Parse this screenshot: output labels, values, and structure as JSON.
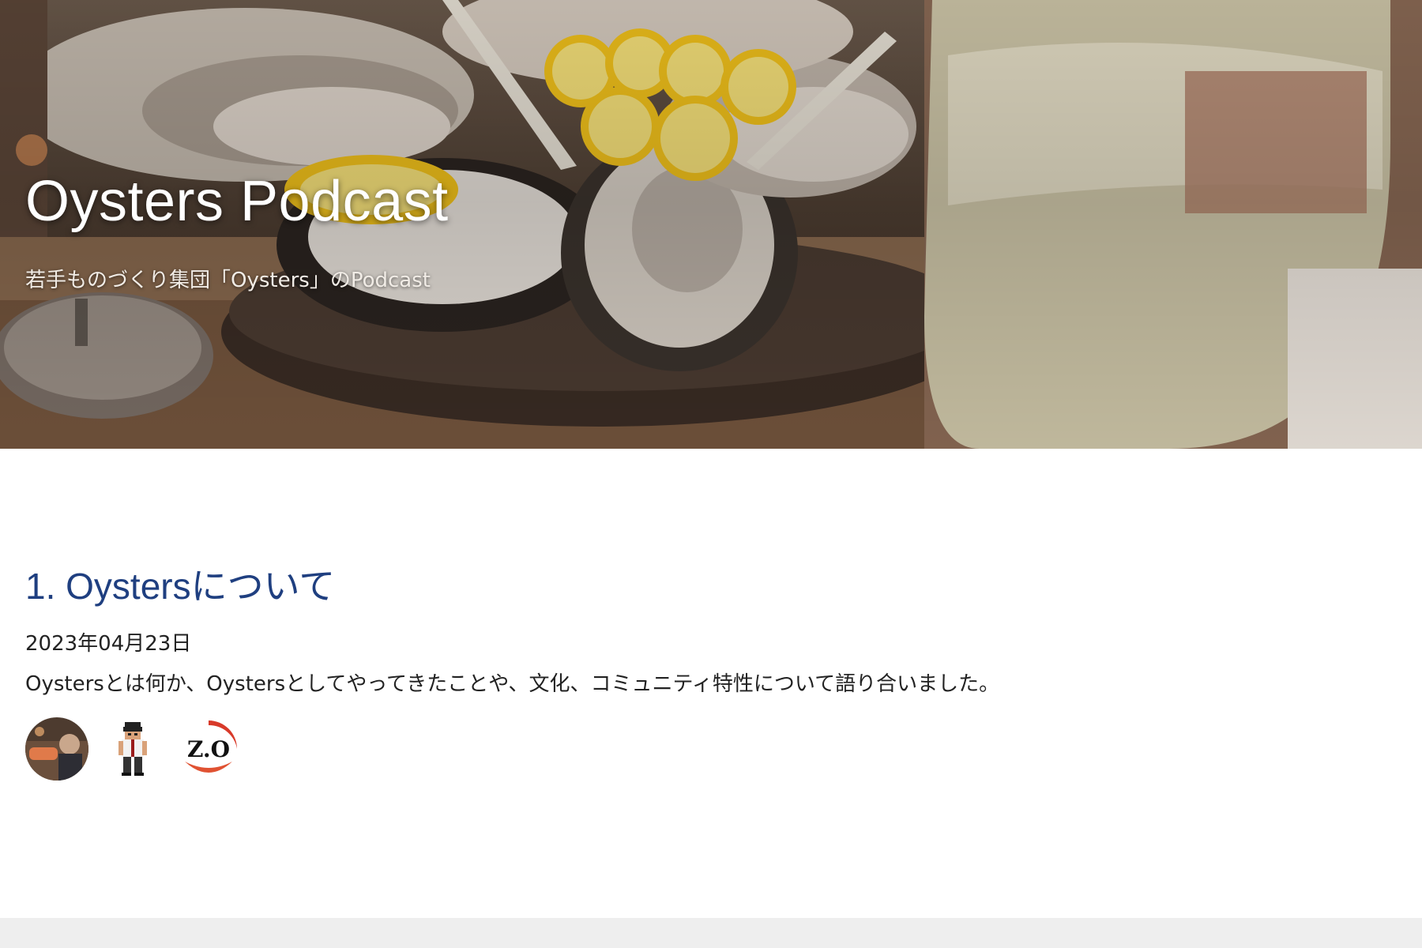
{
  "hero": {
    "title": "Oysters Podcast",
    "subtitle": "若手ものづくり集団「Oysters」のPodcast"
  },
  "episode": {
    "title": "1. Oystersについて",
    "date": "2023年04月23日",
    "description": "Oystersとは何か、Oystersとしてやってきたことや、文化、コミュニティ特性について語り合いました。",
    "avatars": [
      "photo-avatar",
      "pixel-art-avatar",
      "zo-logo-avatar"
    ]
  },
  "colors": {
    "link": "#1f3f80",
    "text": "#222222",
    "footer": "#eeeeee"
  }
}
